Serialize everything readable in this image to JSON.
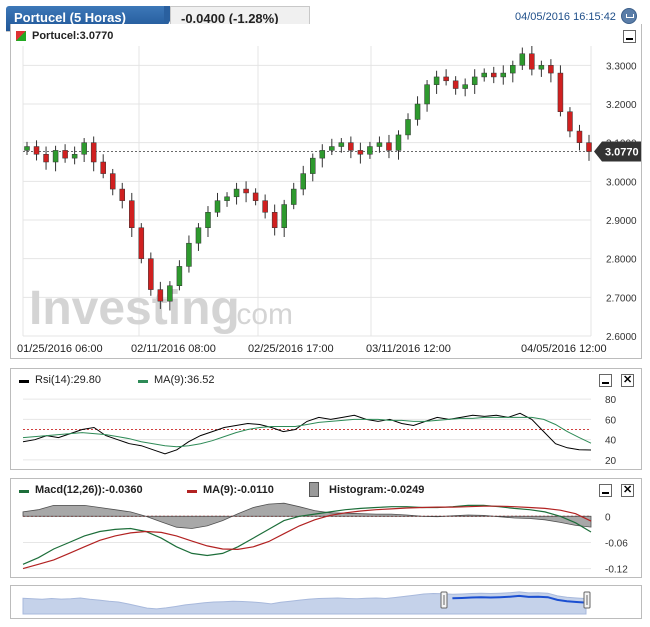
{
  "header": {
    "instrument_tab": "Portucel (5 Horas)",
    "change": "-0.0400 (-1.28%)",
    "datetime": "04/05/2016 16:15:42"
  },
  "main": {
    "legend": "Portucel:3.0770",
    "last_price": "3.0770",
    "watermark": "Investing",
    "watermark_suffix": ".com"
  },
  "rsi": {
    "label_rsi": "Rsi(14):29.80",
    "label_ma": "MA(9):36.52"
  },
  "macd": {
    "label_macd": "Macd(12,26)):-0.0360",
    "label_ma": "MA(9):-0.0110",
    "label_hist": "Histogram:-0.0249"
  },
  "colors": {
    "up": "#2e9a2e",
    "down": "#d02020",
    "rsi_line": "#000000",
    "rsi_ma": "#2e8b57",
    "hist_fill": "#9a9a9a",
    "macd_line": "#1d6e3a",
    "macd_signal": "#b22222",
    "tab_blue": "#2a609f",
    "navigator": "#b8c8e8"
  },
  "chart_data": [
    {
      "type": "candlestick",
      "x_ticks": [
        "01/25/2016 06:00",
        "02/11/2016 08:00",
        "02/25/2016 17:00",
        "03/11/2016 12:00",
        "04/05/2016 12:00"
      ],
      "y_ticks": [
        "3.3000",
        "3.2000",
        "3.1000",
        "3.0000",
        "2.9000",
        "2.8000",
        "2.7000",
        "2.6000"
      ],
      "ylim": [
        2.6,
        3.35
      ],
      "series": [
        {
          "name": "Portucel",
          "values": [
            3.09,
            3.07,
            3.05,
            3.08,
            3.06,
            3.07,
            3.1,
            3.05,
            3.02,
            2.98,
            2.95,
            2.88,
            2.8,
            2.72,
            2.69,
            2.73,
            2.78,
            2.84,
            2.88,
            2.92,
            2.95,
            2.96,
            2.98,
            2.97,
            2.95,
            2.92,
            2.88,
            2.94,
            2.98,
            3.02,
            3.06,
            3.08,
            3.09,
            3.1,
            3.08,
            3.07,
            3.09,
            3.1,
            3.08,
            3.12,
            3.16,
            3.2,
            3.25,
            3.27,
            3.26,
            3.24,
            3.25,
            3.27,
            3.28,
            3.27,
            3.28,
            3.3,
            3.33,
            3.29,
            3.3,
            3.28,
            3.18,
            3.13,
            3.1,
            3.077
          ]
        }
      ]
    },
    {
      "type": "line",
      "y_ticks": [
        "80",
        "60",
        "40",
        "20"
      ],
      "ylim": [
        15,
        90
      ],
      "series": [
        {
          "name": "Rsi(14)",
          "values": [
            38,
            40,
            44,
            42,
            46,
            50,
            52,
            44,
            40,
            36,
            34,
            30,
            26,
            30,
            38,
            44,
            48,
            52,
            54,
            56,
            55,
            52,
            48,
            50,
            58,
            62,
            60,
            62,
            64,
            60,
            58,
            60,
            56,
            54,
            58,
            62,
            60,
            62,
            64,
            63,
            64,
            62,
            66,
            60,
            48,
            36,
            32,
            30,
            29.8
          ]
        },
        {
          "name": "MA(9)",
          "values": [
            42,
            43,
            44,
            45,
            46,
            47,
            46,
            45,
            43,
            41,
            38,
            36,
            34,
            33,
            34,
            36,
            39,
            43,
            47,
            50,
            52,
            53,
            53,
            53,
            55,
            57,
            58,
            59,
            60,
            60,
            60,
            59,
            59,
            58,
            58,
            59,
            60,
            61,
            61,
            62,
            62,
            62,
            62,
            62,
            60,
            55,
            48,
            42,
            36.52
          ]
        }
      ]
    },
    {
      "type": "bar-line",
      "y_ticks": [
        "0",
        "-0.06",
        "-0.12"
      ],
      "ylim": [
        -0.13,
        0.035
      ],
      "series": [
        {
          "name": "Macd(12,26))",
          "values": [
            -0.11,
            -0.095,
            -0.075,
            -0.06,
            -0.045,
            -0.035,
            -0.03,
            -0.028,
            -0.035,
            -0.05,
            -0.07,
            -0.085,
            -0.09,
            -0.085,
            -0.07,
            -0.05,
            -0.03,
            -0.01,
            0.0,
            0.005,
            0.01,
            0.015,
            0.018,
            0.02,
            0.022,
            0.022,
            0.02,
            0.02,
            0.022,
            0.025,
            0.025,
            0.022,
            0.018,
            0.015,
            0.01,
            0.0,
            -0.015,
            -0.036
          ]
        },
        {
          "name": "MA(9)",
          "values": [
            -0.12,
            -0.11,
            -0.1,
            -0.085,
            -0.07,
            -0.055,
            -0.045,
            -0.038,
            -0.035,
            -0.037,
            -0.045,
            -0.057,
            -0.068,
            -0.075,
            -0.076,
            -0.07,
            -0.058,
            -0.04,
            -0.022,
            -0.008,
            0.002,
            0.008,
            0.012,
            0.015,
            0.017,
            0.019,
            0.02,
            0.021,
            0.021,
            0.022,
            0.023,
            0.023,
            0.022,
            0.02,
            0.018,
            0.014,
            0.006,
            -0.011
          ]
        },
        {
          "name": "Histogram",
          "values": [
            0.01,
            0.015,
            0.025,
            0.025,
            0.025,
            0.02,
            0.015,
            0.01,
            0.0,
            -0.013,
            -0.025,
            -0.028,
            -0.022,
            -0.01,
            0.006,
            0.02,
            0.028,
            0.03,
            0.022,
            0.013,
            0.008,
            0.007,
            0.006,
            0.005,
            0.005,
            0.003,
            0.0,
            -0.001,
            0.001,
            0.003,
            0.002,
            -0.001,
            -0.004,
            -0.005,
            -0.008,
            -0.014,
            -0.021,
            -0.0249
          ]
        }
      ]
    }
  ]
}
